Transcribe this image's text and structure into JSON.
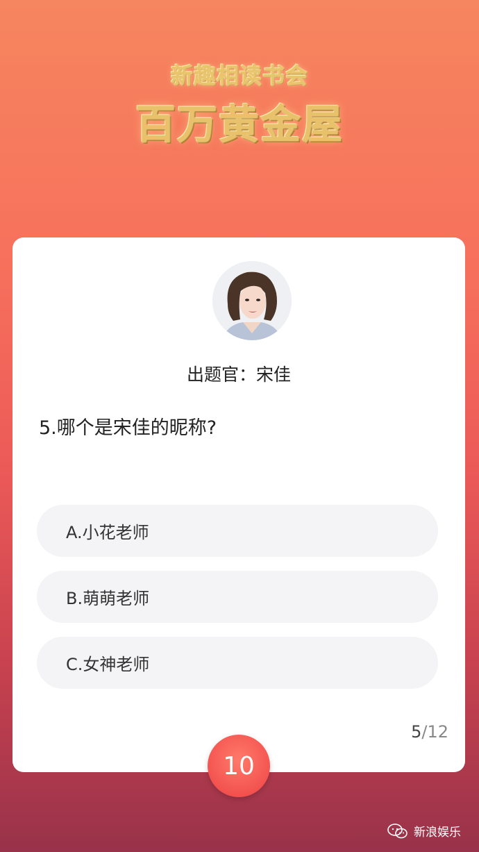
{
  "header": {
    "logo_line1": "新趣相读书会",
    "logo_line2": "百万黄金屋"
  },
  "quiz": {
    "host_label": "出题官：宋佳",
    "question": "5.哪个是宋佳的昵称?",
    "options": [
      {
        "label": "A.小花老师"
      },
      {
        "label": "B.萌萌老师"
      },
      {
        "label": "C.女神老师"
      }
    ],
    "progress": {
      "current": "5",
      "separator": "/",
      "total": "12"
    },
    "timer": "10"
  },
  "watermark": {
    "text": "新浪娱乐",
    "icon": "wechat-icon"
  },
  "colors": {
    "background_top": "#f6865f",
    "background_bottom": "#98324a",
    "timer": "#f2504d",
    "option_bg": "#f4f4f6"
  }
}
